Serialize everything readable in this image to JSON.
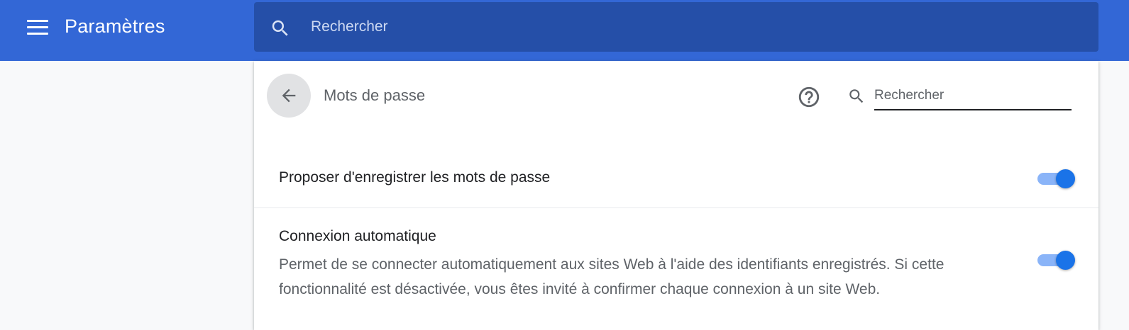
{
  "header": {
    "title": "Paramètres",
    "search_placeholder": "Rechercher",
    "menu_icon": "hamburger-menu-icon",
    "search_icon": "search-icon"
  },
  "page": {
    "title": "Mots de passe",
    "back_icon": "arrow-back-icon",
    "help_icon": "help-circle-icon",
    "search_placeholder": "Rechercher"
  },
  "settings": [
    {
      "label": "Proposer d'enregistrer les mots de passe",
      "enabled": true
    },
    {
      "label": "Connexion automatique",
      "description": "Permet de se connecter automatiquement aux sites Web à l'aide des identifiants enregistrés. Si cette fonctionnalité est désactivée, vous êtes invité à confirmer chaque connexion à un site Web.",
      "enabled": true
    }
  ],
  "colors": {
    "header_bg": "#3367d6",
    "search_bg": "#254fa8",
    "accent": "#1a73e8",
    "toggle_track": "#8ab4f8"
  }
}
